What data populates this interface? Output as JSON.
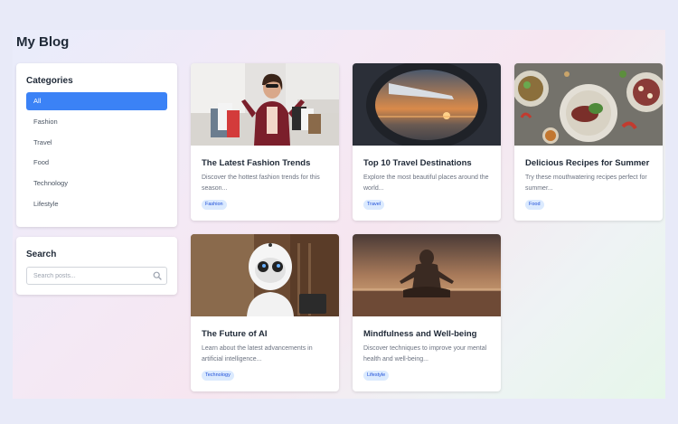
{
  "blog_title": "My Blog",
  "categories": {
    "title": "Categories",
    "items": [
      "All",
      "Fashion",
      "Travel",
      "Food",
      "Technology",
      "Lifestyle"
    ],
    "active": "All"
  },
  "search": {
    "title": "Search",
    "placeholder": "Search posts...",
    "icon": "search-icon"
  },
  "posts": [
    {
      "title": "The Latest Fashion Trends",
      "description": "Discover the hottest fashion trends for this season...",
      "tag": "Fashion"
    },
    {
      "title": "Top 10 Travel Destinations",
      "description": "Explore the most beautiful places around the world...",
      "tag": "Travel"
    },
    {
      "title": "Delicious Recipes for Summer",
      "description": "Try these mouthwatering recipes perfect for summer...",
      "tag": "Food"
    },
    {
      "title": "The Future of AI",
      "description": "Learn about the latest advancements in artificial intelligence...",
      "tag": "Technology"
    },
    {
      "title": "Mindfulness and Well-being",
      "description": "Discover techniques to improve your mental health and well-being...",
      "tag": "Lifestyle"
    }
  ],
  "colors": {
    "accent": "#3b82f6",
    "tag_bg": "#dbeafe",
    "tag_text": "#1d4ed8"
  }
}
